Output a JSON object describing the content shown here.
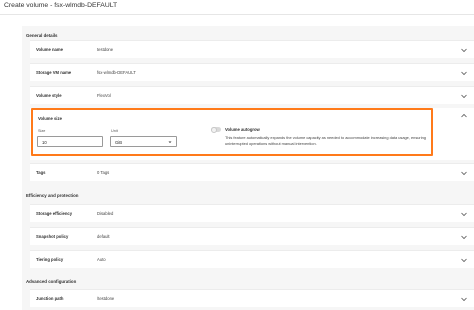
{
  "page": {
    "title": "Create volume - fsx-wlmdb-DEFAULT"
  },
  "general": {
    "title": "General details",
    "rows": [
      {
        "label": "Volume name",
        "value": "testdone"
      },
      {
        "label": "Storage VM name",
        "value": "fsx-wlmdb-DEFAULT"
      },
      {
        "label": "Volume style",
        "value": "FlexVol"
      }
    ],
    "volume_size": {
      "title": "Volume size",
      "size_label": "Size",
      "size_value": "10",
      "unit_label": "Unit",
      "unit_value": "GiB",
      "autogrow_title": "Volume autogrow",
      "autogrow_desc": "This feature automatically expands the volume capacity as needed to accommodate increasing data usage, ensuring uninterrupted operations without manual intervention.",
      "autogrow_enabled": false
    },
    "tags": {
      "label": "Tags",
      "value": "0 Tags"
    }
  },
  "efficiency": {
    "title": "Efficiency and protection",
    "rows": [
      {
        "label": "Storage efficiency",
        "value": "Disabled"
      },
      {
        "label": "Snapshot policy",
        "value": "default"
      },
      {
        "label": "Tiering policy",
        "value": "Auto"
      }
    ]
  },
  "advanced": {
    "title": "Advanced configuration",
    "rows": [
      {
        "label": "Junction path",
        "value": "/testdone"
      }
    ]
  },
  "colors": {
    "highlight": "#ff7a1a",
    "panel_bg": "#f6f6f6"
  },
  "icons": {
    "expand": "chevron-down-icon",
    "collapse": "chevron-up-icon"
  }
}
